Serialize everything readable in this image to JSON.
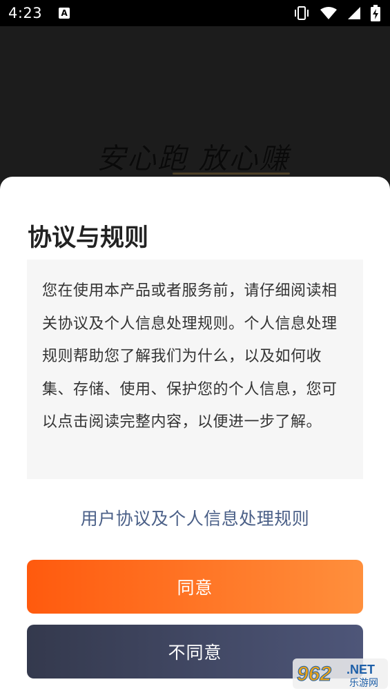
{
  "status_bar": {
    "time": "4:23",
    "notification_icon": "A"
  },
  "splash": {
    "slogan": "安心跑 放心赚"
  },
  "dialog": {
    "title": "协议与规则",
    "body": "您在使用本产品或者服务前，请仔细阅读相关协议及个人信息处理规则。个人信息处理规则帮助您了解我们为什么，以及如何收集、存储、使用、保护您的个人信息，您可以点击阅读完整内容，以便进一步了解。",
    "link": "用户协议及个人信息处理规则",
    "agree_label": "同意",
    "disagree_label": "不同意"
  },
  "watermark": {
    "number": "962",
    "suffix": ".NET",
    "caption": "乐游网"
  },
  "colors": {
    "agree_start": "#ff5a0e",
    "agree_end": "#ff8f3c",
    "disagree_start": "#34394d",
    "disagree_end": "#4e5679",
    "link": "#4a5f87"
  }
}
